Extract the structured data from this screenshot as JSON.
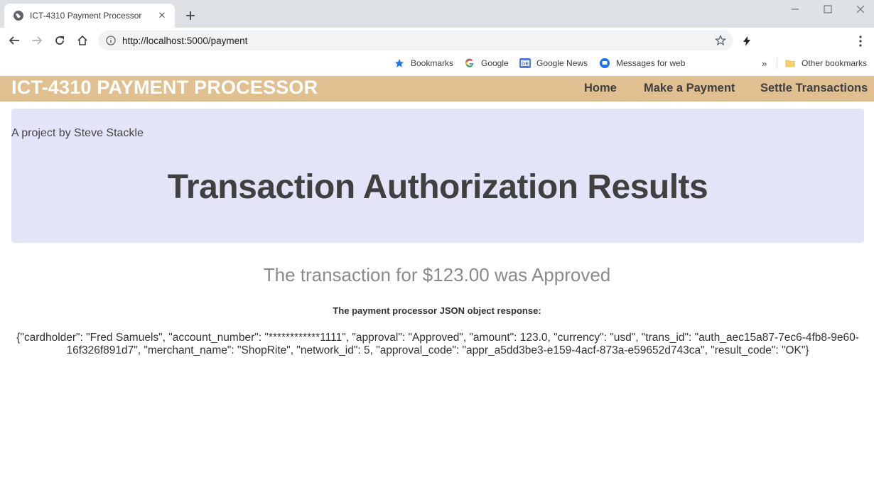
{
  "browser": {
    "tab_title": "ICT-4310 Payment Processor",
    "url": "http://localhost:5000/payment",
    "bookmarks": [
      {
        "label": "Bookmarks",
        "icon": "star-icon"
      },
      {
        "label": "Google",
        "icon": "google-icon"
      },
      {
        "label": "Google News",
        "icon": "google-news-icon"
      },
      {
        "label": "Messages for web",
        "icon": "messages-icon"
      }
    ],
    "other_bookmarks": "Other bookmarks",
    "accent_color": "#1a73e8"
  },
  "header": {
    "brand": "ICT-4310 PAYMENT PROCESSOR",
    "nav": [
      "Home",
      "Make a Payment",
      "Settle Transactions"
    ],
    "color": "#e0bf90"
  },
  "hero": {
    "byline": "A project by Steve Stackle",
    "title": "Transaction Authorization Results",
    "color": "#e4e4f8"
  },
  "result": {
    "message": "The transaction for $123.00 was Approved",
    "response_label": "The payment processor JSON object response:",
    "response_json": "{\"cardholder\": \"Fred Samuels\", \"account_number\": \"************1111\", \"approval\": \"Approved\", \"amount\": 123.0, \"currency\": \"usd\", \"trans_id\": \"auth_aec15a87-7ec6-4fb8-9e60-16f326f891d7\", \"merchant_name\": \"ShopRite\", \"network_id\": 5, \"approval_code\": \"appr_a5dd3be3-e159-4acf-873a-e59652d743ca\", \"result_code\": \"OK\"}"
  }
}
